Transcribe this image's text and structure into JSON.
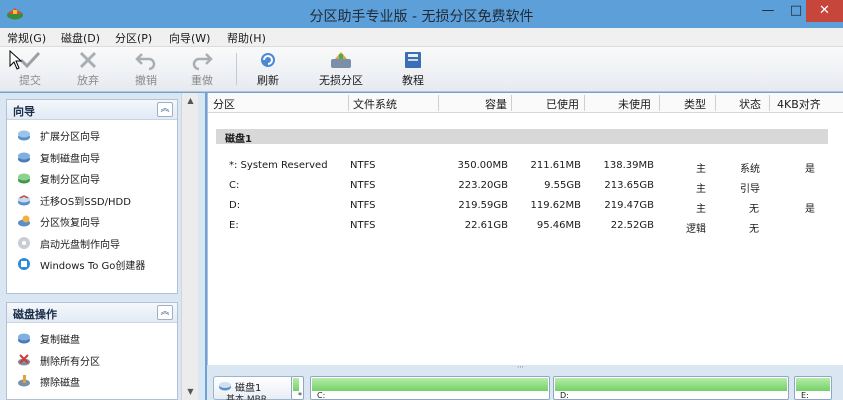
{
  "window": {
    "title": "分区助手专业版 - 无损分区免费软件",
    "minimize": "—",
    "maximize": "□",
    "close": "✕"
  },
  "menu": [
    "常规(G)",
    "磁盘(D)",
    "分区(P)",
    "向导(W)",
    "帮助(H)"
  ],
  "toolbar": [
    {
      "label": "提交",
      "icon": "commit-check-icon",
      "enabled": false
    },
    {
      "label": "放弃",
      "icon": "discard-icon",
      "enabled": false
    },
    {
      "label": "撤销",
      "icon": "undo-icon",
      "enabled": false
    },
    {
      "label": "重做",
      "icon": "redo-icon",
      "enabled": false
    },
    {
      "label": "刷新",
      "icon": "refresh-icon",
      "enabled": true
    },
    {
      "label": "无损分区",
      "icon": "partition-icon",
      "enabled": true
    },
    {
      "label": "教程",
      "icon": "tutorial-book-icon",
      "enabled": true
    }
  ],
  "wizard_panel": {
    "title": "向导",
    "collapse": "︽",
    "items": [
      "扩展分区向导",
      "复制磁盘向导",
      "复制分区向导",
      "迁移OS到SSD/HDD",
      "分区恢复向导",
      "启动光盘制作向导",
      "Windows To Go创建器"
    ]
  },
  "disk_ops_panel": {
    "title": "磁盘操作",
    "collapse": "︽",
    "items": [
      "复制磁盘",
      "删除所有分区",
      "擦除磁盘"
    ]
  },
  "table": {
    "headers": [
      "分区",
      "文件系统",
      "容量",
      "已使用",
      "未使用",
      "类型",
      "状态",
      "4KB对齐"
    ],
    "disk_label": "磁盘1",
    "rows": [
      [
        "*: System Reserved",
        "NTFS",
        "350.00MB",
        "211.61MB",
        "138.39MB",
        "主",
        "系统",
        "是"
      ],
      [
        "C:",
        "NTFS",
        "223.20GB",
        "9.55GB",
        "213.65GB",
        "主",
        "引导",
        ""
      ],
      [
        "D:",
        "NTFS",
        "219.59GB",
        "119.62MB",
        "219.47GB",
        "主",
        "无",
        "是"
      ],
      [
        "E:",
        "NTFS",
        "22.61GB",
        "95.46MB",
        "22.52GB",
        "逻辑",
        "无",
        ""
      ]
    ]
  },
  "disk_map": {
    "disk_label": "磁盘1",
    "disk_sub": "基本 MBR",
    "partitions": [
      {
        "label": "*",
        "used_fraction": 0.6
      },
      {
        "label": "C:",
        "used_fraction": 0.04
      },
      {
        "label": "D:",
        "used_fraction": 0.01
      },
      {
        "label": "E:",
        "used_fraction": 0.01
      }
    ]
  },
  "colors": {
    "title_bar": "#5d9fd8",
    "close_button": "#c7463c",
    "disk_fill": "#74d067",
    "panel_bg": "#dbe6f3"
  }
}
